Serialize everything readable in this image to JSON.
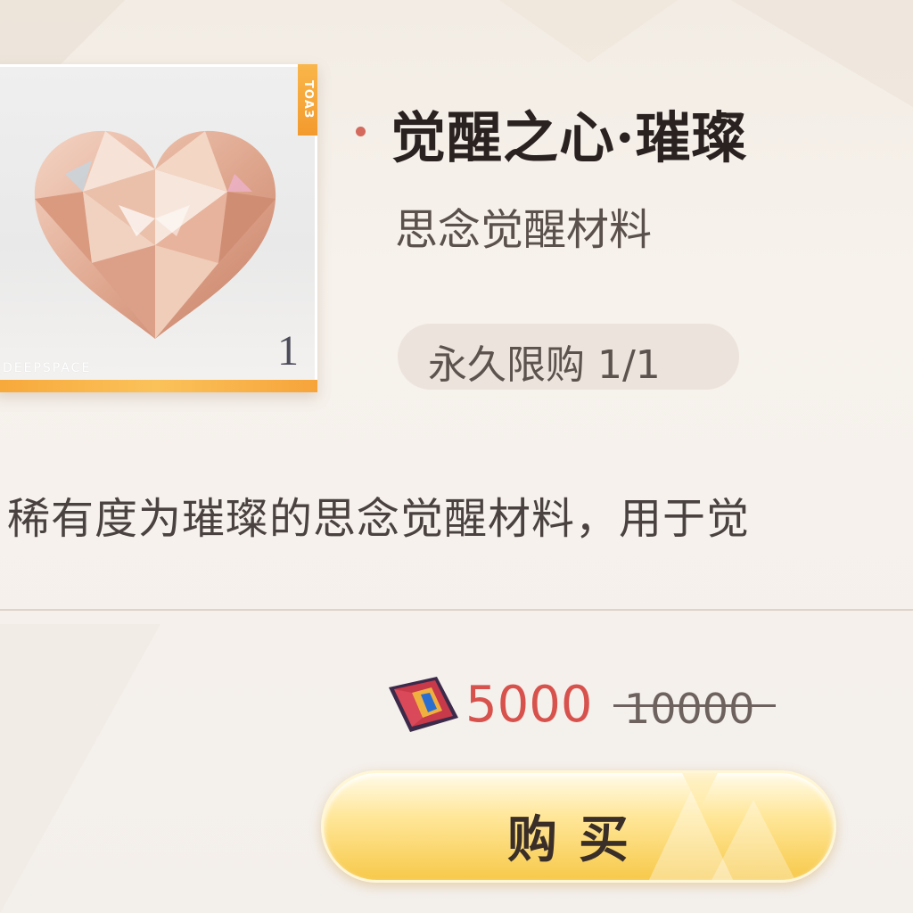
{
  "item": {
    "rarity_tag": "ТОАЗ",
    "watermark": "DEEPSPACE",
    "quantity": "1",
    "icon": "faceted-heart-gem-icon"
  },
  "info": {
    "title": "觉醒之心·璀璨",
    "subtitle": "思念觉醒材料",
    "limit": "永久限购 1/1",
    "description": "稀有度为璀璨的思念觉醒材料，用于觉"
  },
  "price": {
    "currency_icon": "diamond-card-icon",
    "current": "5000",
    "original": "10000"
  },
  "buy_button": {
    "label": "购买"
  },
  "colors": {
    "accent_orange": "#f6a43a",
    "price_red": "#d8524d",
    "title_dot": "#d46a5d",
    "button_gold": "#f7c94a"
  }
}
